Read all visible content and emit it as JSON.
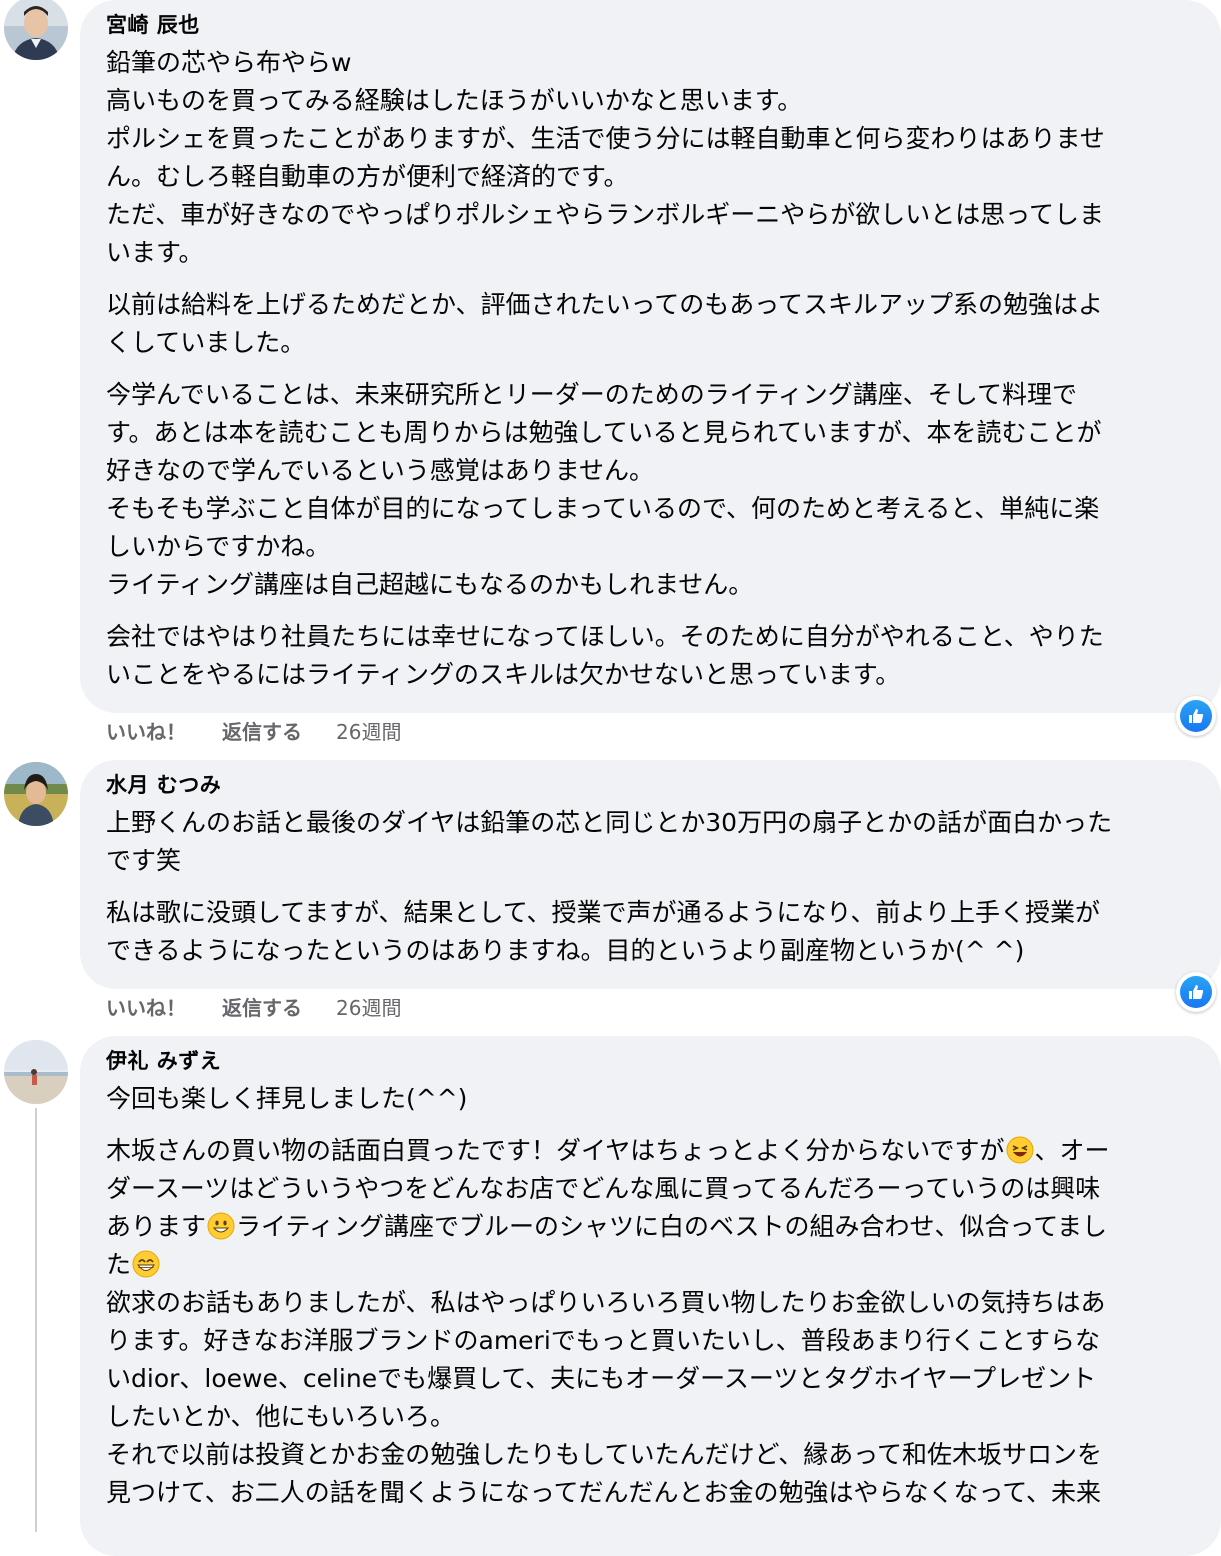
{
  "comments": [
    {
      "author": "宮崎 辰也",
      "paragraphs": [
        [
          "鉛筆の芯やら布やらw",
          "高いものを買ってみる経験はしたほうがいいかなと思います。",
          "ポルシェを買ったことがありますが、生活で使う分には軽自動車と何ら変わりはありませ",
          "ん。むしろ軽自動車の方が便利で経済的です。",
          "ただ、車が好きなのでやっぱりポルシェやらランボルギーニやらが欲しいとは思ってしま",
          "います。"
        ],
        [
          "以前は給料を上げるためだとか、評価されたいってのもあってスキルアップ系の勉強はよ",
          "くしていました。"
        ],
        [
          "今学んでいることは、未来研究所とリーダーのためのライティング講座、そして料理で",
          "す。あとは本を読むことも周りからは勉強していると見られていますが、本を読むことが",
          "好きなので学んでいるという感覚はありません。",
          "そもそも学ぶこと自体が目的になってしまっているので、何のためと考えると、単純に楽",
          "しいからですかね。",
          "ライティング講座は自己超越にもなるのかもしれません。"
        ],
        [
          "会社ではやはり社員たちには幸せになってほしい。そのために自分がやれること、やりた",
          "いことをやるにはライティングのスキルは欠かせないと思っています。"
        ]
      ],
      "like_label": "いいね！",
      "reply_label": "返信する",
      "time": "26週間"
    },
    {
      "author": "水月 むつみ",
      "paragraphs": [
        [
          "上野くんのお話と最後のダイヤは鉛筆の芯と同じとか30万円の扇子とかの話が面白かった",
          "です笑"
        ],
        [
          "私は歌に没頭してますが、結果として、授業で声が通るようになり、前より上手く授業が",
          "できるようになったというのはありますね。目的というより副産物というか(^ ^)"
        ]
      ],
      "like_label": "いいね！",
      "reply_label": "返信する",
      "time": "26週間"
    },
    {
      "author": "伊礼 みずえ",
      "p1": [
        "今回も楽しく拝見しました(^^)"
      ],
      "p2": {
        "l1a": "木坂さんの買い物の話面白買ったです！ダイヤはちょっとよく分からないですが",
        "l1b": "、オー",
        "l2": "ダースーツはどういうやつをどんなお店でどんな風に買ってるんだろーっていうのは興味",
        "l3a": "あります",
        "l3b": "ライティング講座でブルーのシャツに白のベストの組み合わせ、似合ってまし",
        "l4": "た"
      },
      "p3": [
        "欲求のお話もありましたが、私はやっぱりいろいろ買い物したりお金欲しいの気持ちはあ",
        "ります。好きなお洋服ブランドのameriでもっと買いたいし、普段あまり行くことすらな",
        "いdior、loewe、celineでも爆買して、夫にもオーダースーツとタグホイヤープレゼント",
        "したいとか、他にもいろいろ。",
        "それで以前は投資とかお金の勉強したりもしていたんだけど、縁あって和佐木坂サロンを",
        "見つけて、お二人の話を聞くようになってだんだんとお金の勉強はやらなくなって、未来"
      ],
      "emoji_names": [
        "laughing-emoji",
        "grinning-emoji",
        "beaming-emoji"
      ]
    }
  ],
  "colors": {
    "bubble": "#f0f2f5",
    "meta_text": "#65676b",
    "like_blue": "#1877f2"
  }
}
